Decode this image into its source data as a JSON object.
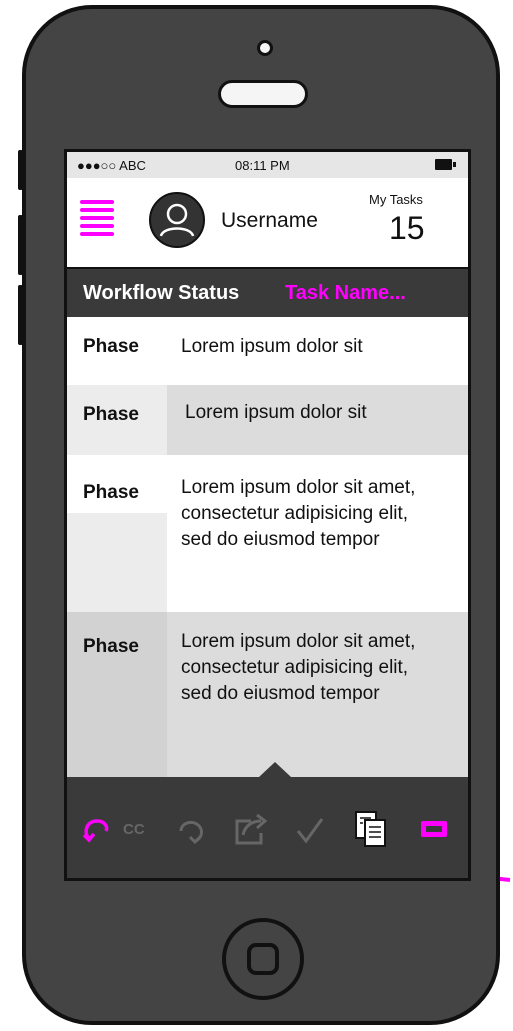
{
  "status_bar": {
    "carrier": "●●●○○ ABC",
    "time": "08:11 PM"
  },
  "header": {
    "username": "Username",
    "tasks_label": "My Tasks",
    "tasks_count": "15"
  },
  "workflow": {
    "label": "Workflow Status",
    "task_name": "Task Name..."
  },
  "rows": [
    {
      "phase": "Phase",
      "text": "Lorem ipsum dolor sit"
    },
    {
      "phase": "Phase",
      "text": "Lorem ipsum dolor sit"
    },
    {
      "phase": "Phase",
      "text": "Lorem ipsum dolor sit amet, consectetur adipisicing elit, sed do eiusmod tempor"
    },
    {
      "phase": "Phase",
      "text": "Lorem ipsum dolor sit amet, consectetur adipisicing elit, sed do eiusmod tempor"
    }
  ],
  "toolbar": {
    "cc_label": "CC",
    "icons": [
      "undo-icon",
      "cc-icon",
      "redo-icon",
      "share-icon",
      "check-icon",
      "copy-icon",
      "battery-toggle-icon"
    ]
  },
  "colors": {
    "accent": "#ff00ff",
    "bar_dark": "#3a3a3a",
    "row_gray": "#dcdcdc",
    "phase_gray": "#ececec"
  }
}
